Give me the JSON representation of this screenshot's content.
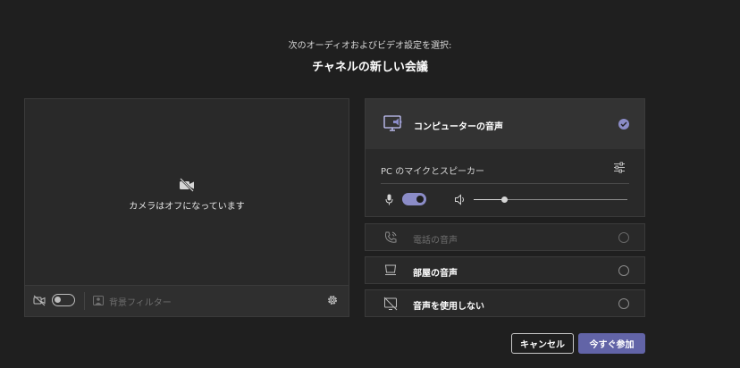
{
  "header": {
    "subtitle": "次のオーディオおよびビデオ設定を選択:",
    "title": "チャネルの新しい会議"
  },
  "video_preview": {
    "camera_off_text": "カメラはオフになっています",
    "camera_toggle_on": false,
    "background_filter_label": "背景フィルター",
    "icons": [
      "camera-off-icon",
      "background-filter-icon",
      "gear-icon"
    ]
  },
  "audio_options": {
    "computer": {
      "label": "コンピューターの音声",
      "selected": true,
      "device_label": "PC のマイクとスピーカー",
      "mic_on": true,
      "volume_fraction": 0.2,
      "icons": [
        "computer-audio-icon",
        "check-icon",
        "device-settings-icon",
        "mic-icon",
        "speaker-icon"
      ]
    },
    "phone": {
      "label": "電話の音声",
      "enabled": false,
      "icon": "phone-icon"
    },
    "room": {
      "label": "部屋の音声",
      "icon": "room-icon"
    },
    "none": {
      "label": "音声を使用しない",
      "icon": "no-audio-icon"
    }
  },
  "actions": {
    "cancel_label": "キャンセル",
    "join_label": "今すぐ参加"
  },
  "colors": {
    "background": "#1f1f1f",
    "panel": "#292929",
    "accent": "#6264a7",
    "toggle_on": "#8b8cc7"
  }
}
